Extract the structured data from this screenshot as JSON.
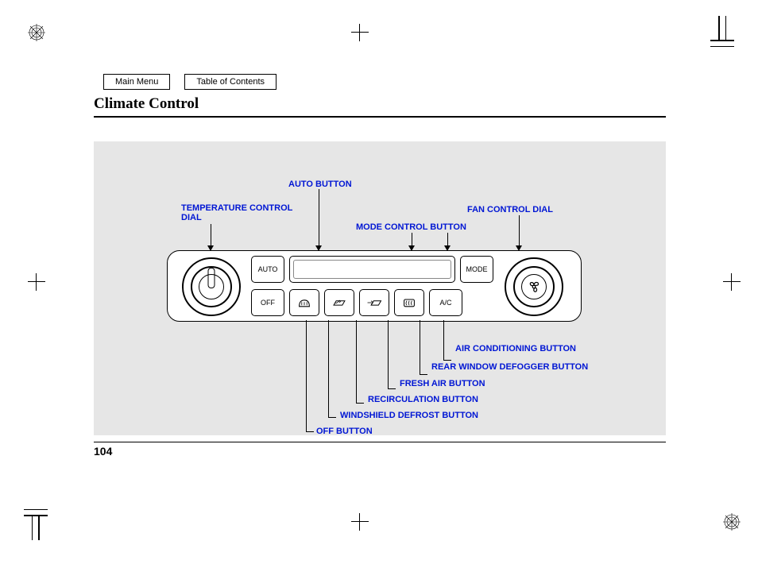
{
  "nav": {
    "main_menu": "Main Menu",
    "toc": "Table of Contents"
  },
  "title": "Climate Control",
  "page_number": "104",
  "labels": {
    "auto": "AUTO BUTTON",
    "tempdial_l1": "TEMPERATURE CONTROL",
    "tempdial_l2": "DIAL",
    "mode": "MODE CONTROL BUTTON",
    "fandial": "FAN CONTROL DIAL",
    "ac": "AIR CONDITIONING BUTTON",
    "reardefog": "REAR WINDOW DEFOGGER BUTTON",
    "fresh": "FRESH AIR BUTTON",
    "recirc": "RECIRCULATION BUTTON",
    "defrost": "WINDSHIELD DEFROST BUTTON",
    "off": "OFF BUTTON"
  },
  "buttons": {
    "auto": "AUTO",
    "mode": "MODE",
    "off": "OFF",
    "ac": "A/C"
  }
}
